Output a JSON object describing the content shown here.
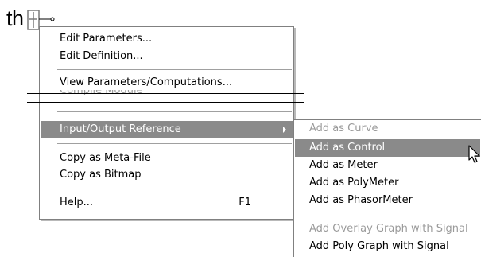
{
  "background": {
    "partial_text": "th"
  },
  "icons": {
    "component": "component-block-icon",
    "submenu_arrow": "chevron-right-icon",
    "cursor": "mouse-pointer-icon"
  },
  "colors": {
    "highlight": "#8a8a8a",
    "disabled_text": "#9a9a9a",
    "menu_border": "#808080"
  },
  "context_menu": {
    "items": [
      {
        "label": "Edit Parameters...",
        "enabled": true
      },
      {
        "label": "Edit Definition...",
        "enabled": true
      },
      {
        "label": "View Parameters/Computations...",
        "enabled": true
      },
      {
        "label": "Compile Module",
        "enabled": false
      },
      {
        "label": "Input/Output Reference",
        "enabled": true,
        "highlighted": true,
        "has_submenu": true
      },
      {
        "label": "Copy as Meta-File",
        "enabled": true
      },
      {
        "label": "Copy as Bitmap",
        "enabled": true
      },
      {
        "label": "Help...",
        "shortcut": "F1",
        "enabled": true
      }
    ]
  },
  "submenu": {
    "items": [
      {
        "label": "Add as Curve",
        "enabled": false
      },
      {
        "label": "Add as Control",
        "enabled": true,
        "highlighted": true
      },
      {
        "label": "Add as Meter",
        "enabled": true
      },
      {
        "label": "Add as PolyMeter",
        "enabled": true
      },
      {
        "label": "Add as PhasorMeter",
        "enabled": true
      },
      {
        "label": "Add Overlay Graph with Signal",
        "enabled": false
      },
      {
        "label": "Add Poly Graph with Signal",
        "enabled": true
      }
    ]
  }
}
